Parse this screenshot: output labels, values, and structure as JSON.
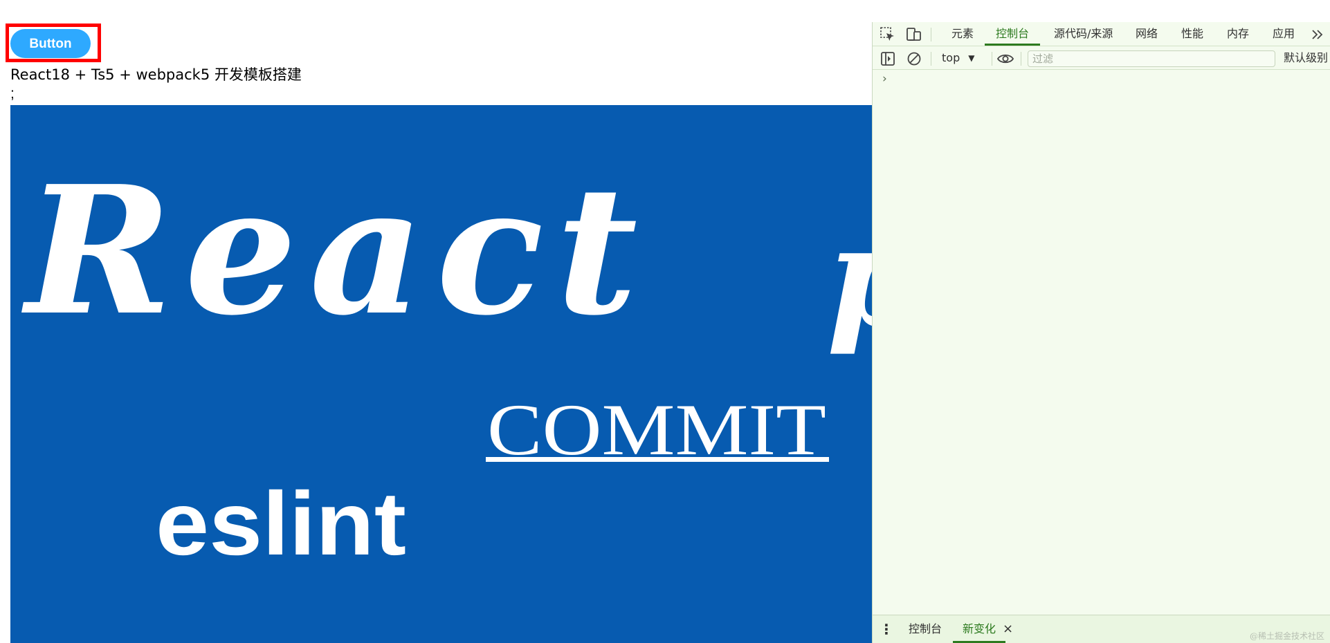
{
  "page": {
    "button_label": "Button",
    "heading": "React18 + Ts5 + webpack5 开发模板搭建",
    "semicolon": ";",
    "banner": {
      "background": "#075bb0",
      "word_react": "React",
      "word_commit": "COMMIT",
      "word_eslint": "eslint",
      "partial_glyph": "p"
    },
    "highlight_color": "#ff0000",
    "button_color": "#2ea9ff"
  },
  "devtools": {
    "tabs": [
      "元素",
      "控制台",
      "源代码/来源",
      "网络",
      "性能",
      "内存",
      "应用"
    ],
    "active_tab": "控制台",
    "more_icon": "chevron-double-right-icon",
    "toolbar": {
      "context": "top",
      "filter_placeholder": "过滤",
      "levels": "默认级别"
    },
    "prompt": "›",
    "drawer": {
      "menu": "⋮",
      "tabs": [
        "控制台",
        "新变化"
      ],
      "active": "新变化",
      "close": "×"
    },
    "accent_color": "#2d7a1f",
    "background": "#f4fbee"
  },
  "watermark": "@稀土掘金技术社区"
}
